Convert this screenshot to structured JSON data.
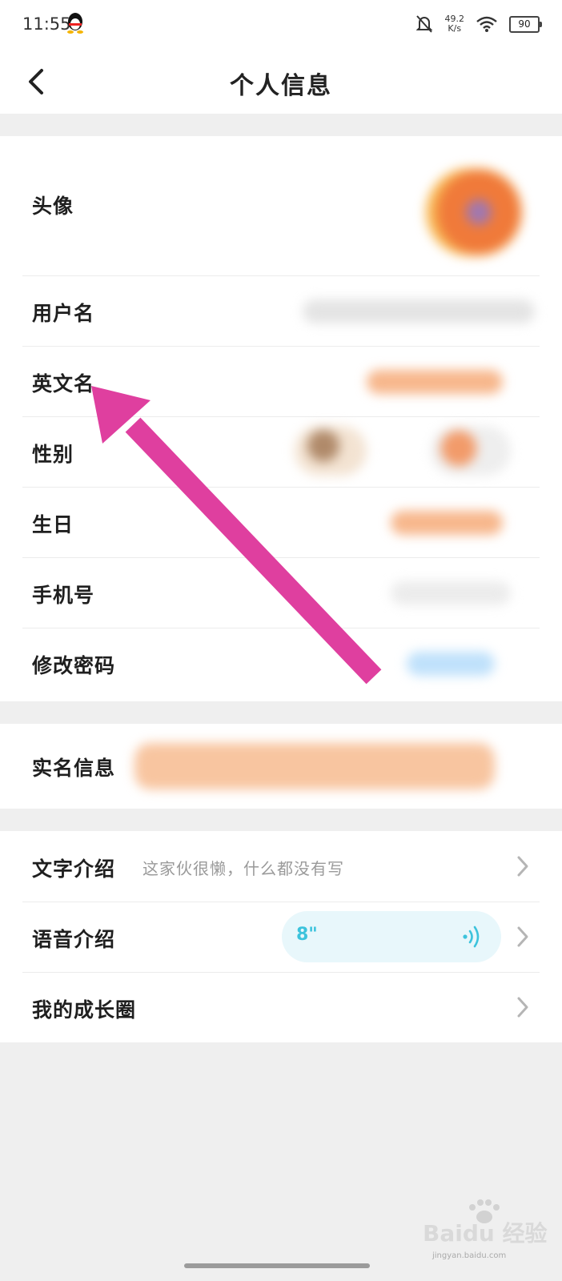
{
  "status_bar": {
    "time": "11:55",
    "net_speed_value": "49.2",
    "net_speed_unit": "K/s",
    "battery": "90"
  },
  "header": {
    "title": "个人信息"
  },
  "profile_section": {
    "rows": [
      {
        "label": "头像"
      },
      {
        "label": "用户名"
      },
      {
        "label": "英文名"
      },
      {
        "label": "性别"
      },
      {
        "label": "生日"
      },
      {
        "label": "手机号"
      },
      {
        "label": "修改密码"
      }
    ]
  },
  "realname_section": {
    "label": "实名信息"
  },
  "intro_section": {
    "text_intro_label": "文字介绍",
    "text_intro_value": "这家伙很懒，什么都没有写",
    "voice_intro_label": "语音介绍",
    "voice_duration": "8\"",
    "growth_label": "我的成长圈"
  },
  "watermark": {
    "text": "Baidu 经验",
    "url": "jingyan.baidu.com"
  },
  "colors": {
    "arrow": "#df3f9f",
    "voice_accent": "#3cc3dc",
    "blur_orange": "#f5a66d"
  }
}
